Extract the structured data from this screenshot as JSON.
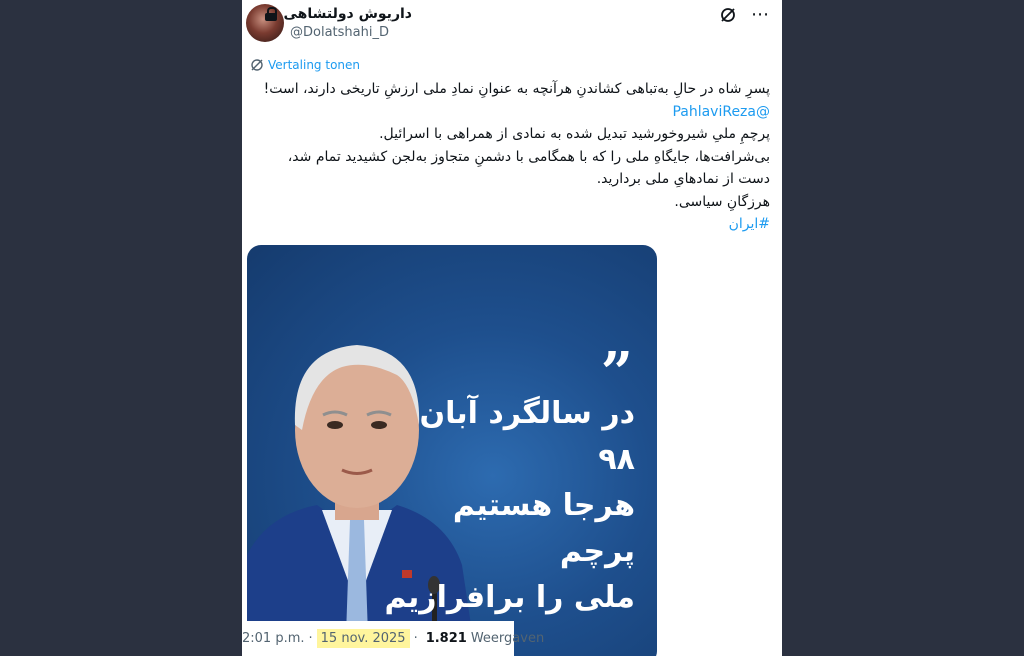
{
  "tweet": {
    "display_name": "داریوش دولتشاهی",
    "handle": "@Dolatshahi_D",
    "translate_label": "Vertaling tonen",
    "lines": [
      "پسرِ شاه در حالِ به‌تباهی کشاندنِ هرآنچه به عنوانِ نمادِ ملی ارزشِ تاریخی دارند، است!",
      "@PahlaviReza",
      "پرچمِ ملیِ شیروخورشید تبدیل شده به نمادی از همراهی با اسرائیل.",
      "بی‌شرافت‌ها، جایگاهِ ملی را که با همگامی با دشمنِ متجاوز به‌لجن کشیدید تمام شد،",
      "دست از نمادهایِ ملی بردارید.",
      "هرزگانِ سیاسی.",
      "#ایران"
    ],
    "image": {
      "quote_mark": "”",
      "overlay_lines": [
        "در سالگرد آبان ۹۸",
        "هرجا هستیم پرچم",
        "ملی را برافرازیم"
      ]
    },
    "footer": {
      "time": "2:01 p.m.",
      "separator": "·",
      "date": "15 nov. 2025",
      "views_count": "1.821",
      "views_label": "Weergaven"
    }
  },
  "icons": {
    "lock": "lock-icon",
    "grok": "grok-icon",
    "more": "more-icon",
    "translate": "translate-icon"
  },
  "colors": {
    "link": "#1d9bf0",
    "background": "#2b3140",
    "date_highlight": "#fff59d"
  }
}
